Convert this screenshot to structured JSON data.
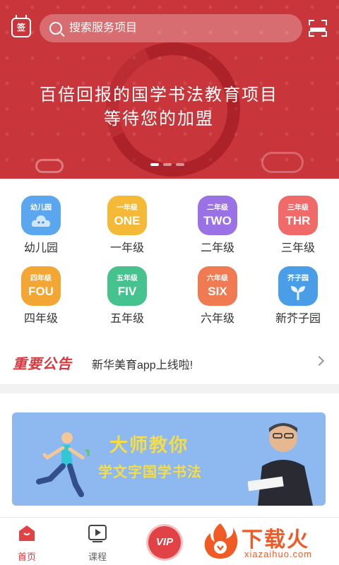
{
  "banner": {
    "sign_label": "签",
    "search_placeholder": "搜索服务项目",
    "title": "百倍回报的国学书法教育项目",
    "subtitle": "等待您的加盟",
    "slides": 3,
    "active_slide": 1
  },
  "grid": {
    "items": [
      {
        "label": "幼儿园",
        "top": "幼儿园",
        "big": "",
        "color": "#5aa7ef",
        "icon": "cloud-mascot-icon"
      },
      {
        "label": "一年级",
        "top": "一年级",
        "big": "ONE",
        "color": "#f5b938"
      },
      {
        "label": "二年级",
        "top": "二年级",
        "big": "TWO",
        "color": "#9a72e6"
      },
      {
        "label": "三年级",
        "top": "三年级",
        "big": "THR",
        "color": "#f06a6a"
      },
      {
        "label": "四年级",
        "top": "四年级",
        "big": "FOU",
        "color": "#f4a634"
      },
      {
        "label": "五年级",
        "top": "五年级",
        "big": "FIV",
        "color": "#45c28e"
      },
      {
        "label": "六年级",
        "top": "六年级",
        "big": "SIX",
        "color": "#f07a52"
      },
      {
        "label": "新芥子园",
        "top": "芥子园",
        "big": "",
        "color": "#4a9ee8",
        "icon": "sprout-icon"
      }
    ]
  },
  "notice": {
    "tag": "重要公告",
    "text": "新华美育app上线啦!"
  },
  "promo": {
    "title": "大师教你",
    "subtitle": "学文字国学书法"
  },
  "tabbar": {
    "home": "首页",
    "course": "课程",
    "vip": "VIP",
    "watermark_main": "下载火",
    "watermark_sub": "xiazaihuo.com"
  }
}
